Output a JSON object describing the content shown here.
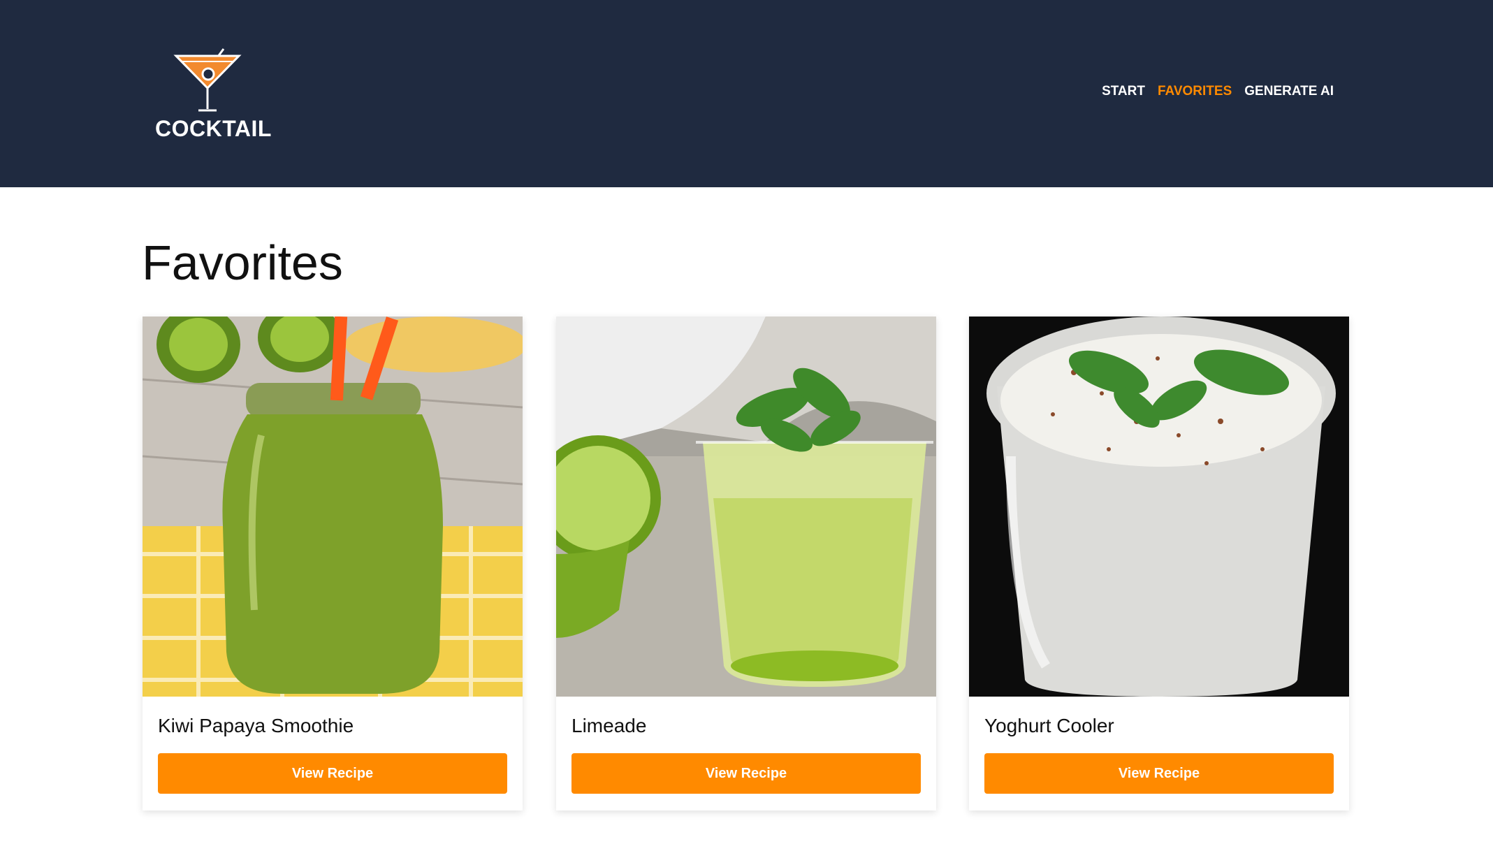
{
  "brand": {
    "name": "COCKTAIL",
    "accent": "#ff8a00",
    "header_bg": "#1f2a40"
  },
  "nav": {
    "items": [
      {
        "label": "START",
        "active": false
      },
      {
        "label": "FAVORITES",
        "active": true
      },
      {
        "label": "GENERATE AI",
        "active": false
      }
    ]
  },
  "main": {
    "title": "Favorites",
    "cards": [
      {
        "title": "Kiwi Papaya Smoothie",
        "button": "View Recipe",
        "image": "kiwi-smoothie-photo"
      },
      {
        "title": "Limeade",
        "button": "View Recipe",
        "image": "limeade-photo"
      },
      {
        "title": "Yoghurt Cooler",
        "button": "View Recipe",
        "image": "yoghurt-cooler-photo"
      }
    ]
  }
}
